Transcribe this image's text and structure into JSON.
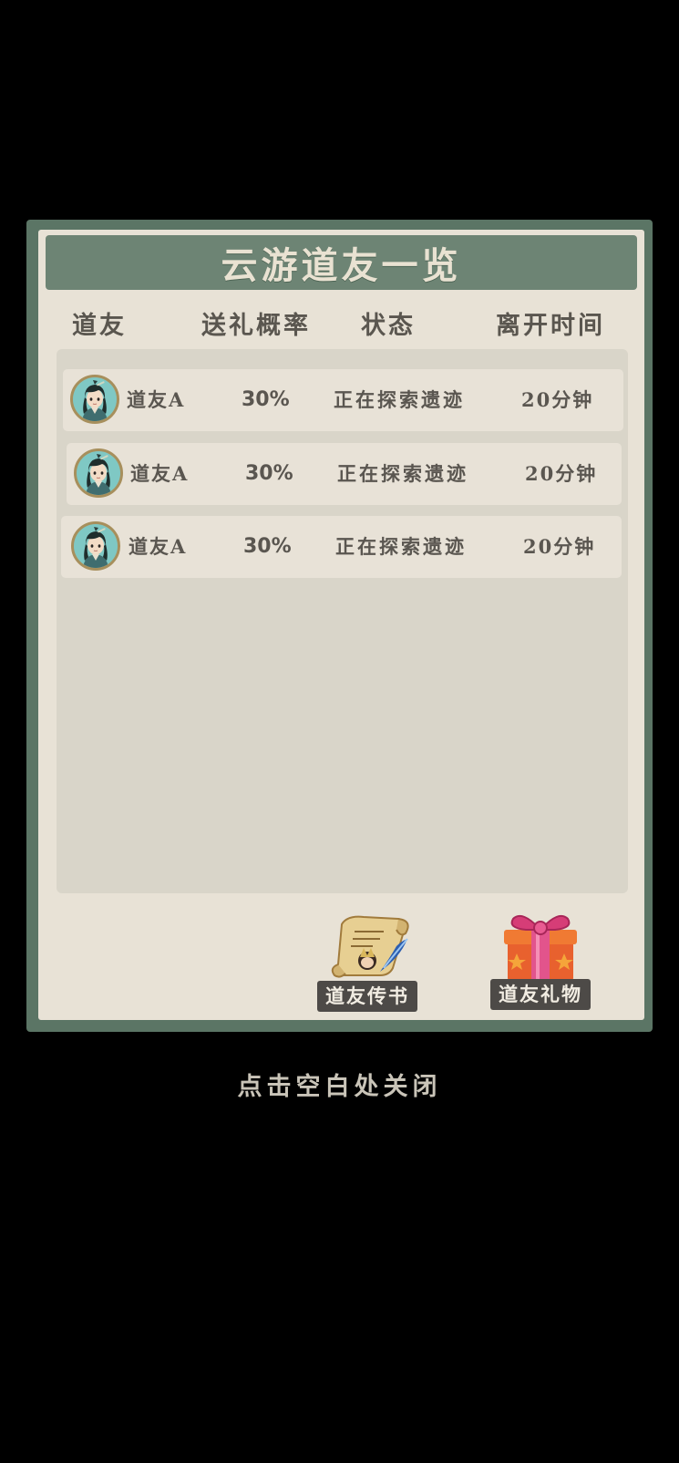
{
  "dialog": {
    "title": "云游道友一览",
    "columns": {
      "friend": "道友",
      "gift_rate": "送礼概率",
      "status": "状态",
      "leave_time": "离开时间"
    },
    "rows": [
      {
        "name": "道友A",
        "gift_rate": "30%",
        "status": "正在探索遗迹",
        "leave_time": "20分钟",
        "avatar_icon": "character-portrait-icon"
      },
      {
        "name": "道友A",
        "gift_rate": "30%",
        "status": "正在探索遗迹",
        "leave_time": "20分钟",
        "avatar_icon": "character-portrait-icon"
      },
      {
        "name": "道友A",
        "gift_rate": "30%",
        "status": "正在探索遗迹",
        "leave_time": "20分钟",
        "avatar_icon": "character-portrait-icon"
      }
    ],
    "buttons": {
      "letter": {
        "label": "道友传书",
        "icon": "scroll-letter-icon"
      },
      "gift": {
        "label": "道友礼物",
        "icon": "gift-box-icon"
      }
    }
  },
  "close_hint": "点击空白处关闭",
  "colors": {
    "frame": "#5b7565",
    "title_bar": "#6d8474",
    "panel": "#e8e2d6",
    "list_bg": "#d9d5c9",
    "row_bg": "#e8e2d7",
    "text": "#5a5650"
  }
}
